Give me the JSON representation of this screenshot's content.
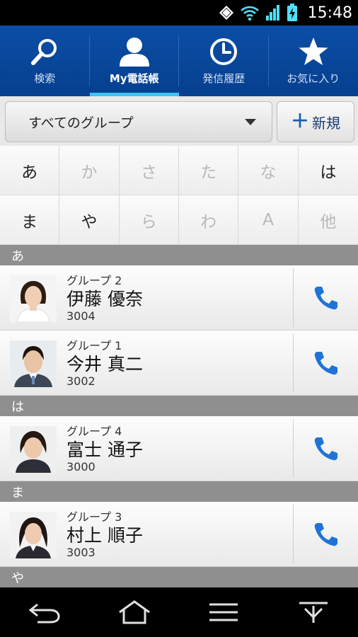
{
  "status_bar": {
    "time": "15:48",
    "icons": [
      "sync-icon",
      "wifi-icon",
      "signal-icon",
      "battery-charging-icon"
    ]
  },
  "tabs": [
    {
      "label": "検索",
      "icon": "search-icon",
      "active": false
    },
    {
      "label": "My電話帳",
      "icon": "person-icon",
      "active": true
    },
    {
      "label": "発信履歴",
      "icon": "clock-icon",
      "active": false
    },
    {
      "label": "お気に入り",
      "icon": "star-icon",
      "active": false
    }
  ],
  "group_selector": {
    "value": "すべてのグループ"
  },
  "new_button": {
    "plus": "＋",
    "label": "新規"
  },
  "index": [
    {
      "char": "あ",
      "enabled": true
    },
    {
      "char": "か",
      "enabled": false
    },
    {
      "char": "さ",
      "enabled": false
    },
    {
      "char": "た",
      "enabled": false
    },
    {
      "char": "な",
      "enabled": false
    },
    {
      "char": "は",
      "enabled": true
    },
    {
      "char": "ま",
      "enabled": true
    },
    {
      "char": "や",
      "enabled": true
    },
    {
      "char": "ら",
      "enabled": false
    },
    {
      "char": "わ",
      "enabled": false
    },
    {
      "char": "A",
      "enabled": false
    },
    {
      "char": "他",
      "enabled": false
    }
  ],
  "sections": [
    {
      "header": "あ",
      "contacts": [
        {
          "group": "グループ 2",
          "name": "伊藤 優奈",
          "ext": "3004"
        },
        {
          "group": "グループ 1",
          "name": "今井 真二",
          "ext": "3002"
        }
      ]
    },
    {
      "header": "は",
      "contacts": [
        {
          "group": "グループ 4",
          "name": "富士 通子",
          "ext": "3000"
        }
      ]
    },
    {
      "header": "ま",
      "contacts": [
        {
          "group": "グループ 3",
          "name": "村上 順子",
          "ext": "3003"
        }
      ]
    },
    {
      "header": "や",
      "contacts": []
    }
  ],
  "colors": {
    "tab_bar": "#0b4ea6",
    "tab_active_indicator": "#3fc4f4",
    "call_icon": "#1f73d6",
    "section_header": "#8f8f8f"
  },
  "nav_bar": {
    "icons": [
      "back-icon",
      "home-icon",
      "menu-icon",
      "recents-icon"
    ]
  }
}
